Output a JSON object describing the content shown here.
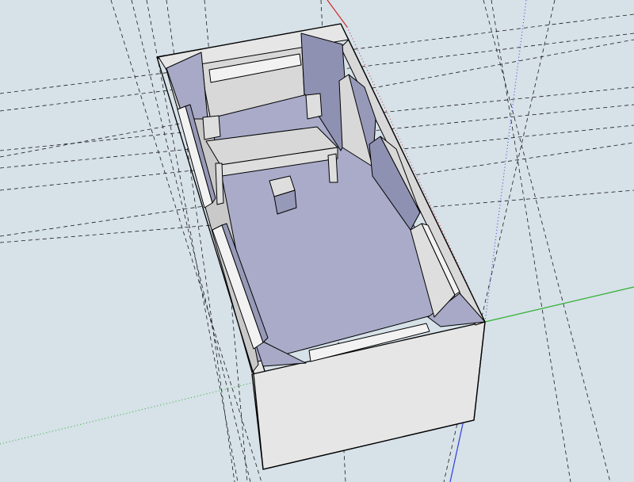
{
  "scene": {
    "background_color": "#d6e1e8",
    "axis_colors": {
      "red": "#d42a2a",
      "green": "#2cb02c",
      "blue": "#2f3ed8"
    },
    "floor_color": "#a9abc9",
    "wall_color": "#e6e6e6"
  }
}
